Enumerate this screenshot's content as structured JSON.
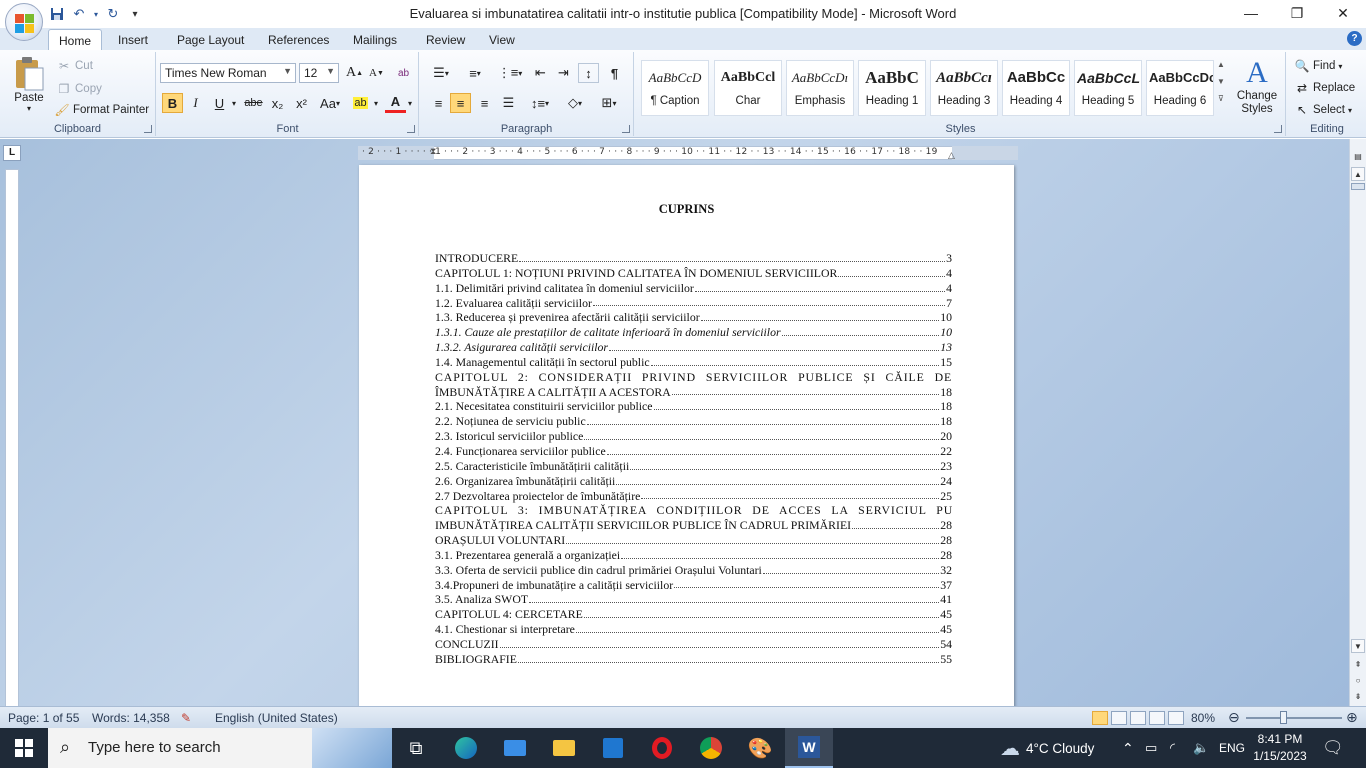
{
  "window": {
    "title": "Evaluarea si imbunatatirea calitatii intr-o  institutie publica [Compatibility Mode] - Microsoft Word"
  },
  "qat": {
    "icons": [
      "save-icon",
      "undo-icon",
      "redo-icon",
      "customize-icon"
    ]
  },
  "tabs": [
    {
      "label": "Home",
      "active": true
    },
    {
      "label": "Insert"
    },
    {
      "label": "Page Layout"
    },
    {
      "label": "References"
    },
    {
      "label": "Mailings"
    },
    {
      "label": "Review"
    },
    {
      "label": "View"
    }
  ],
  "ribbon": {
    "clipboard": {
      "label": "Clipboard",
      "paste": "Paste",
      "cut": "Cut",
      "copy": "Copy",
      "format_painter": "Format Painter"
    },
    "font": {
      "label": "Font",
      "family": "Times New Roman",
      "size": "12",
      "bold": "B",
      "italic": "I",
      "underline": "U",
      "strike": "abe",
      "sub": "x₂",
      "sup": "x²",
      "change_case": "Aa",
      "grow": "A",
      "shrink": "A"
    },
    "paragraph": {
      "label": "Paragraph"
    },
    "styles": {
      "label": "Styles",
      "items": [
        {
          "sample": "AaBbCcD",
          "name": "¶ Caption"
        },
        {
          "sample": "AaBbCcl",
          "name": "Char"
        },
        {
          "sample": "AaBbCcDı",
          "name": "Emphasis"
        },
        {
          "sample": "AaBbC",
          "name": "Heading 1"
        },
        {
          "sample": "AaBbCcı",
          "name": "Heading 3"
        },
        {
          "sample": "AaBbCc",
          "name": "Heading 4"
        },
        {
          "sample": "AaBbCcL",
          "name": "Heading 5"
        },
        {
          "sample": "AaBbCcDc",
          "name": "Heading 6"
        }
      ],
      "change_styles": "Change Styles"
    },
    "editing": {
      "label": "Editing",
      "find": "Find",
      "replace": "Replace",
      "select": "Select"
    }
  },
  "ruler": {
    "labels": "· 2 · · · 1 · · · · · 1 · · · 2 · · · 3 · · · 4 · · · 5 · · · 6 · · · 7 · · · 8 · · · 9 · · · 10 · · 11 · · 12 · · 13 · · 14 · · 15 · · 16 · · 17 · · 18 · · 19"
  },
  "document": {
    "heading": "CUPRINS",
    "toc": [
      {
        "text": "INTRODUCERE",
        "page": "3"
      },
      {
        "text": "CAPITOLUL 1: NOȚIUNI PRIVIND CALITATEA ÎN DOMENIUL SERVICIILOR",
        "page": "4"
      },
      {
        "text": "1.1. Delimitări privind calitatea în domeniul serviciilor",
        "page": "4"
      },
      {
        "text": "1.2. Evaluarea calității serviciilor",
        "page": "7"
      },
      {
        "text": "1.3. Reducerea și prevenirea afectării calității serviciilor",
        "page": "10"
      },
      {
        "text": "1.3.1. Cauze ale prestațiilor de calitate inferioară în domeniul serviciilor",
        "page": "10",
        "italic": true
      },
      {
        "text": "1.3.2. Asigurarea calității serviciilor",
        "page": "13",
        "italic": true
      },
      {
        "text": "1.4. Managementul calității în sectorul public",
        "page": "15"
      },
      {
        "text": "CAPITOLUL 2: CONSIDERAȚII PRIVIND SERVICIILOR PUBLICE ȘI CĂILE DE",
        "page": "",
        "justified": true
      },
      {
        "text": "ÎMBUNĂTĂȚIRE A CALITĂȚII  A ACESTORA",
        "page": "18"
      },
      {
        "text": "2.1. Necesitatea constituirii serviciilor publice",
        "page": "18"
      },
      {
        "text": "2.2. Noțiunea de serviciu public",
        "page": "18"
      },
      {
        "text": "2.3. Istoricul serviciilor publice",
        "page": "20"
      },
      {
        "text": "2.4. Funcționarea serviciilor publice",
        "page": "22"
      },
      {
        "text": "2.5. Caracteristicile îmbunătățirii calității",
        "page": "23"
      },
      {
        "text": "2.6. Organizarea îmbunătățirii calității",
        "page": "24"
      },
      {
        "text": "2.7 Dezvoltarea proiectelor de îmbunătățire",
        "page": "25"
      },
      {
        "text": "CAPITOLUL 3: IMBUNATĂȚIREA CONDIȚIILOR DE ACCES LA SERVICIUL PUBLIC ȘI",
        "page": "",
        "justified": true
      },
      {
        "text": "IMBUNĂTĂȚIREA CALITĂȚII SERVICIILOR PUBLICE ÎN CADRUL  PRIMĂRIEI",
        "page": "28"
      },
      {
        "text": "ORAȘULUI VOLUNTARI",
        "page": "28"
      },
      {
        "text": "3.1. Prezentarea generală a organizației",
        "page": "28"
      },
      {
        "text": "3.3. Oferta de servicii publice din cadrul primăriei Orașului Voluntari",
        "page": "32"
      },
      {
        "text": "3.4.Propuneri de imbunatățire  a calității serviciilor",
        "page": "37"
      },
      {
        "text": "3.5. Analiza SWOT",
        "page": "41"
      },
      {
        "text": "CAPITOLUL 4: CERCETARE",
        "page": "45"
      },
      {
        "text": "4.1. Chestionar si interpretare",
        "page": "45"
      },
      {
        "text": "CONCLUZII",
        "page": "54"
      },
      {
        "text": "BIBLIOGRAFIE",
        "page": "55"
      }
    ]
  },
  "status": {
    "page": "Page: 1 of 55",
    "words": "Words: 14,358",
    "language": "English (United States)",
    "zoom": "80%",
    "zoom_percent": 80
  },
  "taskbar": {
    "search_placeholder": "Type here to search",
    "weather": "4°C  Cloudy",
    "lang": "ENG",
    "time": "8:41 PM",
    "date": "1/15/2023"
  }
}
